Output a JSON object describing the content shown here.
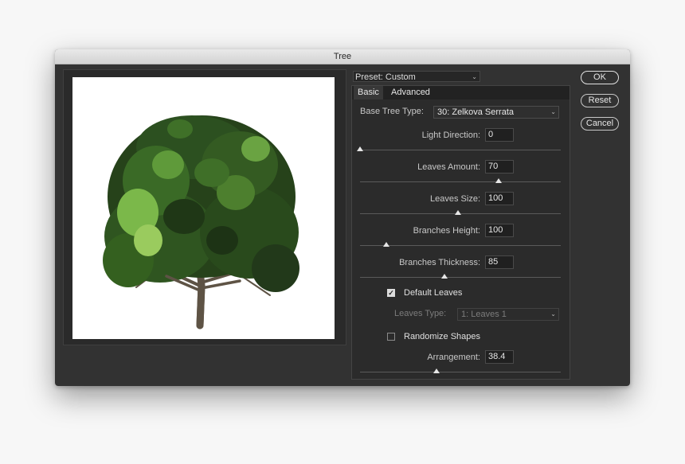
{
  "window": {
    "title": "Tree"
  },
  "preset": {
    "label": "Preset: Custom"
  },
  "tabs": {
    "basic": "Basic",
    "advanced": "Advanced"
  },
  "base_tree_type": {
    "label": "Base Tree Type:",
    "value": "30: Zelkova Serrata"
  },
  "light_direction": {
    "label": "Light Direction:",
    "value": "0",
    "fraction": 0.0
  },
  "leaves_amount": {
    "label": "Leaves Amount:",
    "value": "70",
    "fraction": 0.69
  },
  "leaves_size": {
    "label": "Leaves Size:",
    "value": "100",
    "fraction": 0.49
  },
  "branches_height": {
    "label": "Branches Height:",
    "value": "100",
    "fraction": 0.13
  },
  "branches_thickness": {
    "label": "Branches Thickness:",
    "value": "85",
    "fraction": 0.42
  },
  "default_leaves": {
    "label": "Default Leaves",
    "checked": true
  },
  "leaves_type": {
    "label": "Leaves Type:",
    "value": "1: Leaves 1"
  },
  "randomize_shapes": {
    "label": "Randomize Shapes",
    "checked": false
  },
  "arrangement": {
    "label": "Arrangement:",
    "value": "38.4",
    "fraction": 0.38
  },
  "buttons": {
    "ok": "OK",
    "reset": "Reset",
    "cancel": "Cancel"
  },
  "icons": {
    "dropdown": "chevron-down-icon",
    "check": "checkmark-icon"
  }
}
